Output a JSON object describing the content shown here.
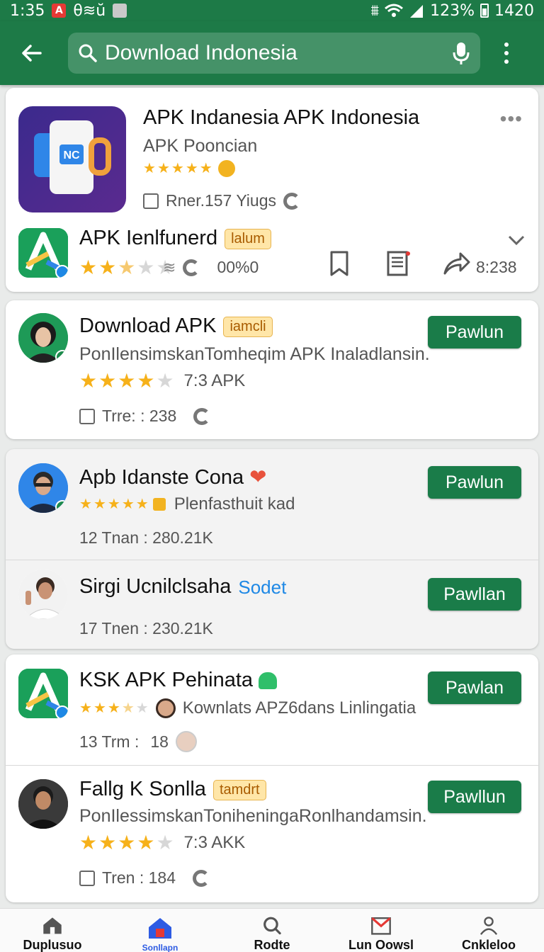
{
  "status": {
    "time": "1:35",
    "left_extra": "θ≋ŭ",
    "battery_pct": "123%",
    "right_num": "1420"
  },
  "search": {
    "query": "Download Indonesia"
  },
  "top_card": {
    "main": {
      "title": "APK Indanesia APK Indonesia",
      "subtitle": "APK Pooncian",
      "meta": "Rner.157 Yiugs"
    },
    "second": {
      "title": "APK Ienlfunerd",
      "badge": "lalum",
      "pct": "00%0",
      "count": "8:238"
    }
  },
  "results": [
    {
      "title": "Download APK",
      "badge": "iamcli",
      "desc": "PonIlensimskanTomheqim APK Inaladlansin.",
      "rating_text": "7:3 APK",
      "meta": "Trre: : 238",
      "button": "Pawlun"
    },
    {
      "title": "Apb Idanste Cona",
      "rating_text": "Plenfasthuit kad",
      "meta": "12 Tnan : 280.21K",
      "button": "Pawlun"
    },
    {
      "title": "Sirgi Ucnilclsaha",
      "badge": "Sodet",
      "meta": "17 Tnen : 230.21K",
      "button": "Pawllan"
    },
    {
      "title": "KSK APK Pehinata",
      "rating_text": "Kownlats APZ6dans Linlingatia",
      "meta_a": "13 Trm :",
      "meta_b": "18",
      "button": "Pawlan"
    },
    {
      "title": "Fallg K Sonlla",
      "badge": "tamdrt",
      "desc": "PonIlessimskanToniheningaRonlhandamsin.",
      "rating_text": "7:3 AKK",
      "meta": "Tren : 184",
      "button": "Pawllun"
    }
  ],
  "bottom_nav": [
    "Duplusuo",
    "Sonllapn",
    "Rodte",
    "Lun Oowsl",
    "Cnkleloo"
  ],
  "colors": {
    "brand": "#1d7a47",
    "button": "#1a7c49",
    "star": "#f6b11a",
    "active_nav": "#2d5be3"
  }
}
